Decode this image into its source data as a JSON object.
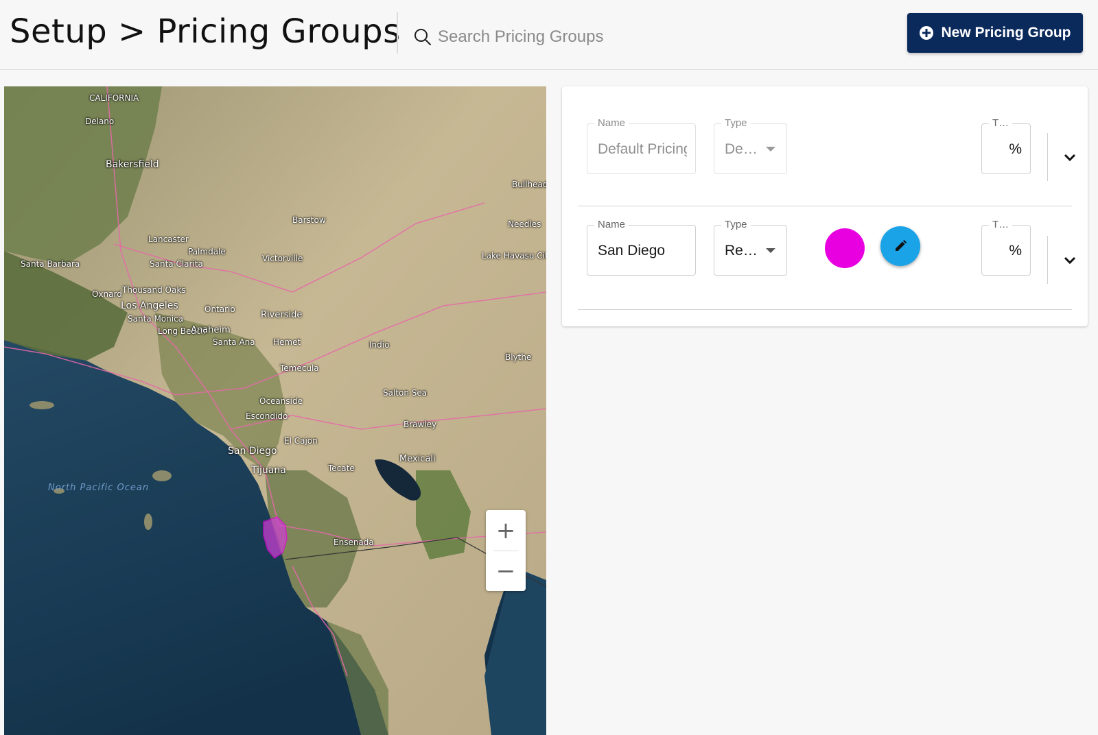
{
  "header": {
    "title": "Setup > Pricing Groups",
    "search_placeholder": "Search Pricing Groups",
    "new_button_label": "New Pricing Group"
  },
  "colors": {
    "primary": "#0b2a5c",
    "fab": "#1ba3e8",
    "san_diego_swatch": "#e800e0"
  },
  "map": {
    "zoom_in": "+",
    "zoom_out": "−",
    "labels": {
      "california": "CALIFORNIA",
      "delano": "Delano",
      "bakersfield": "Bakersfield",
      "lancaster": "Lancaster",
      "palmdale": "Palmdale",
      "santa_clarita": "Santa Clarita",
      "victorville": "Victorville",
      "santa_barbara": "Santa Barbara",
      "oxnard": "Oxnard",
      "thousand_oaks": "Thousand Oaks",
      "los_angeles": "Los Angeles",
      "santa_monica": "Santa Monica",
      "long_beach": "Long Beach",
      "ontario": "Ontario",
      "riverside": "Riverside",
      "anaheim": "Anaheim",
      "santa_ana": "Santa Ana",
      "hemet": "Hemet",
      "temecula": "Temecula",
      "oceanside": "Oceanside",
      "escondido": "Escondido",
      "san_diego": "San Diego",
      "el_cajon": "El Cajon",
      "tijuana": "Tijuana",
      "tecate": "Tecate",
      "mexicali": "Mexicali",
      "ensenada": "Ensenada",
      "indio": "Indio",
      "barstow": "Barstow",
      "needles": "Needles",
      "bullhead_city": "Bullhead City",
      "lake_havasu_city": "Lake Havasu City",
      "blythe": "Blythe",
      "brawley": "Brawley",
      "salton_sea": "Salton Sea",
      "pacific_ocean": "North Pacific Ocean"
    }
  },
  "groups": [
    {
      "name_label": "Name",
      "name_value": "Default Pricing",
      "type_label": "Type",
      "type_value": "De…",
      "third_label": "T…",
      "third_value": "%"
    },
    {
      "name_label": "Name",
      "name_value": "San Diego",
      "type_label": "Type",
      "type_value": "Re…",
      "third_label": "T…",
      "third_value": "%"
    }
  ]
}
